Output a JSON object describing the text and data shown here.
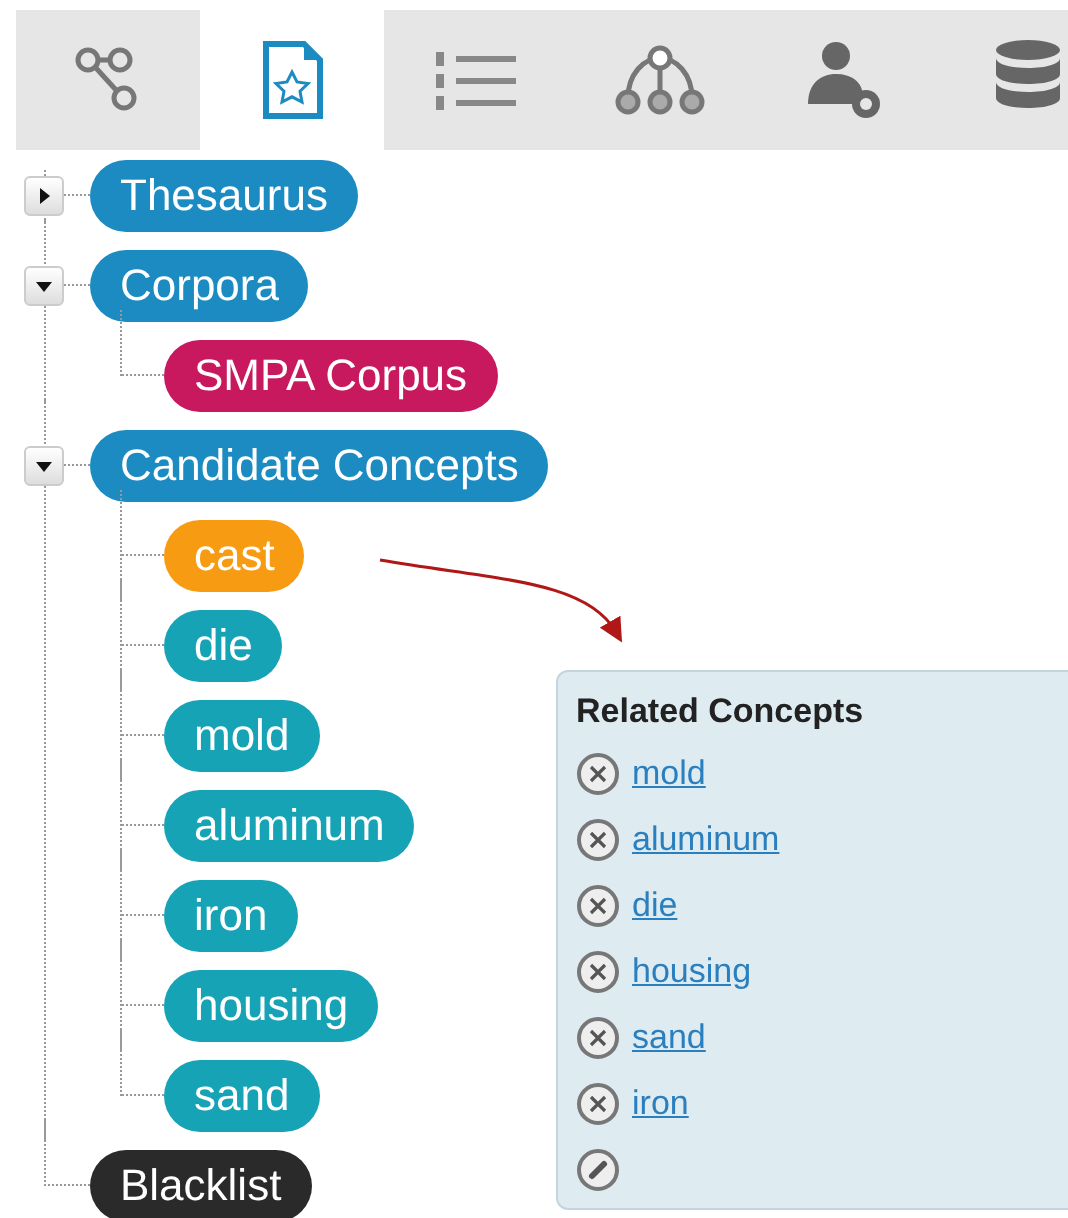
{
  "toolbar": {
    "tabs": [
      {
        "kind": "graph",
        "selected": false
      },
      {
        "kind": "document",
        "selected": true
      },
      {
        "kind": "list",
        "selected": false
      },
      {
        "kind": "hierarchy",
        "selected": false
      },
      {
        "kind": "user-settings",
        "selected": false
      },
      {
        "kind": "database",
        "selected": false
      }
    ]
  },
  "tree": [
    {
      "label": "Thesaurus",
      "color": "#1b8bc2",
      "expanded": false
    },
    {
      "label": "Corpora",
      "color": "#1b8bc2",
      "expanded": true,
      "children": [
        {
          "label": "SMPA Corpus",
          "color": "#c8195f"
        }
      ]
    },
    {
      "label": "Candidate Concepts",
      "color": "#1b8bc2",
      "expanded": true,
      "children": [
        {
          "label": "cast",
          "color": "#f79c12"
        },
        {
          "label": "die",
          "color": "#17a3b6"
        },
        {
          "label": "mold",
          "color": "#17a3b6"
        },
        {
          "label": "aluminum",
          "color": "#17a3b6"
        },
        {
          "label": "iron",
          "color": "#17a3b6"
        },
        {
          "label": "housing",
          "color": "#17a3b6"
        },
        {
          "label": "sand",
          "color": "#17a3b6"
        }
      ]
    },
    {
      "label": "Blacklist",
      "color": "#2a2a2a"
    }
  ],
  "related_panel": {
    "title": "Related Concepts",
    "items": [
      "mold",
      "aluminum",
      "die",
      "housing",
      "sand",
      "iron"
    ]
  }
}
